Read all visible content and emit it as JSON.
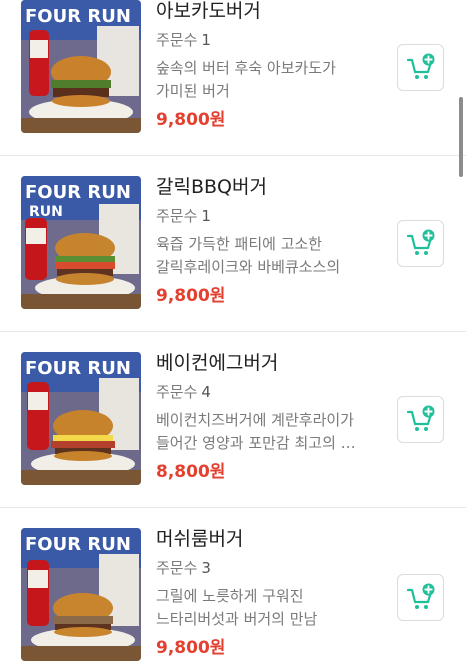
{
  "menu": {
    "order_label": "주문수",
    "items": [
      {
        "name": "아보카도버거",
        "order_count": "1",
        "description": "숲속의 버터 후숙 아보카도가 가미된 버거",
        "price": "9,800원"
      },
      {
        "name": "갈릭BBQ버거",
        "order_count": "1",
        "description": "육즙 가득한 패티에 고소한 갈릭후레이크와 바베큐소스의 조화…",
        "price": "9,800원"
      },
      {
        "name": "베이컨에그버거",
        "order_count": "4",
        "description": "베이컨치즈버거에 계란후라이가 들어간 영양과 포만감 최고의 …",
        "price": "8,800원"
      },
      {
        "name": "머쉬룸버거",
        "order_count": "3",
        "description": "그릴에 노릇하게 구워진 느타리버섯과 버거의 만남",
        "price": "9,800원"
      }
    ]
  },
  "colors": {
    "price": "#e4402f",
    "cart_icon": "#1fbf9a"
  },
  "icons": {
    "cart_add": "cart-add-icon"
  }
}
